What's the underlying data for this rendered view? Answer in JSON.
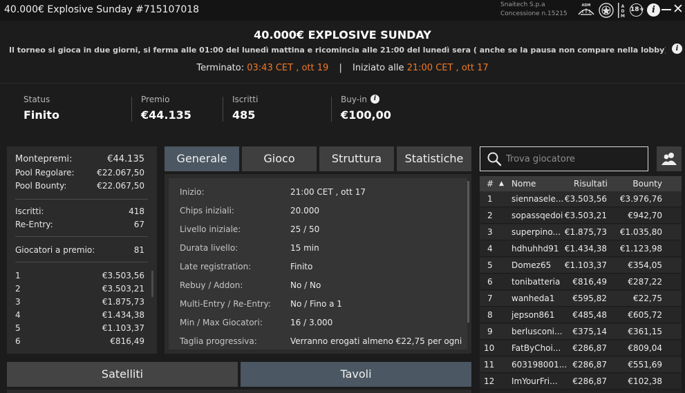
{
  "window": {
    "title": "40.000€ Explosive Sunday #715107018",
    "company_line1": "Snaitech S.p.a",
    "company_line2": "Concessione n.15215",
    "adm_text": "ADM",
    "age_badge": "18+",
    "icons": [
      "adm-ship-logo",
      "state-emblem-logo",
      "adm-logo",
      "age-18-icon",
      "info-icon",
      "minimize-icon",
      "close-icon"
    ]
  },
  "header": {
    "tournament_name": "40.000€ EXPLOSIVE SUNDAY",
    "description": "Il torneo si gioca in due giorni, si ferma alle 01:00 del lunedì mattina e ricomincia alle 21:00 del lunedì sera ( anche se la pausa non compare nella lobby)....",
    "ended_label": "Terminato:",
    "ended_value": "03:43 CET , ott 19",
    "separator": "|",
    "started_label": "Iniziato alle",
    "started_value": "21:00 CET , ott 17"
  },
  "stats": {
    "status_label": "Status",
    "status_value": "Finito",
    "prize_label": "Premio",
    "prize_value": "€44.135",
    "entrants_label": "Iscritti",
    "entrants_value": "485",
    "buyin_label": "Buy-in",
    "buyin_value": "€100,00"
  },
  "prize_panel": {
    "monte_label": "Montepremi:",
    "monte_value": "€44.135",
    "pool_reg_label": "Pool Regolare:",
    "pool_reg_value": "€22.067,50",
    "pool_bounty_label": "Pool Bounty:",
    "pool_bounty_value": "€22.067,50",
    "iscritti_label": "Iscritti:",
    "iscritti_value": "418",
    "reentry_label": "Re-Entry:",
    "reentry_value": "67",
    "paid_label": "Giocatori a premio:",
    "paid_value": "81",
    "places": [
      {
        "pos": "1",
        "amount": "€3.503,56"
      },
      {
        "pos": "2",
        "amount": "€3.503,21"
      },
      {
        "pos": "3",
        "amount": "€1.875,73"
      },
      {
        "pos": "4",
        "amount": "€1.434,38"
      },
      {
        "pos": "5",
        "amount": "€1.103,37"
      },
      {
        "pos": "6",
        "amount": "€816,49"
      }
    ]
  },
  "tabs": [
    "Generale",
    "Gioco",
    "Struttura",
    "Statistiche"
  ],
  "active_tab": "Generale",
  "general": [
    {
      "label": "Inizio:",
      "value": "21:00 CET , ott 17"
    },
    {
      "label": "Chips iniziali:",
      "value": "20.000"
    },
    {
      "label": "Livello iniziale:",
      "value": "25 / 50"
    },
    {
      "label": "Durata livello:",
      "value": "15 min"
    },
    {
      "label": "Late registration:",
      "value": "Finito"
    },
    {
      "label": "Rebuy / Addon:",
      "value": "No / No"
    },
    {
      "label": "Multi-Entry / Re-Entry:",
      "value": "No / Fino a 1"
    },
    {
      "label": "Min / Max Giocatori:",
      "value": "16 / 3.000"
    },
    {
      "label": "Taglia progressiva:",
      "value": "Verranno erogati almeno €22,75 per ogni"
    }
  ],
  "buttons": {
    "satelliti": "Satelliti",
    "tavoli": "Tavoli"
  },
  "search": {
    "placeholder": "Trova giocatore"
  },
  "players": {
    "headers": {
      "rank": "#",
      "sort": "▲",
      "name": "Nome",
      "results": "Risultati",
      "bounty": "Bounty"
    },
    "rows": [
      {
        "rank": "1",
        "name": "siennasele...",
        "result": "€3.503,56",
        "bounty": "€3.976,76"
      },
      {
        "rank": "2",
        "name": "sopassqedoi",
        "result": "€3.503,21",
        "bounty": "€942,70"
      },
      {
        "rank": "3",
        "name": "superpino...",
        "result": "€1.875,73",
        "bounty": "€1.035,80"
      },
      {
        "rank": "4",
        "name": "hdhuhhd91",
        "result": "€1.434,38",
        "bounty": "€1.123,98"
      },
      {
        "rank": "5",
        "name": "Domez65",
        "result": "€1.103,37",
        "bounty": "€354,05"
      },
      {
        "rank": "6",
        "name": "tonibatteria",
        "result": "€816,49",
        "bounty": "€287,22"
      },
      {
        "rank": "7",
        "name": "wanheda1",
        "result": "€595,82",
        "bounty": "€22,75"
      },
      {
        "rank": "8",
        "name": "jepson861",
        "result": "€485,48",
        "bounty": "€605,72"
      },
      {
        "rank": "9",
        "name": "berlusconi...",
        "result": "€375,14",
        "bounty": "€361,15"
      },
      {
        "rank": "10",
        "name": "FatByChoi...",
        "result": "€286,87",
        "bounty": "€809,04"
      },
      {
        "rank": "11",
        "name": "603198001...",
        "result": "€286,87",
        "bounty": "€551,69"
      },
      {
        "rank": "12",
        "name": "ImYourFri...",
        "result": "€286,87",
        "bounty": "€102,38"
      }
    ]
  },
  "colors": {
    "accent_orange": "#f07a2a",
    "active_tab": "#4b5762",
    "panel": "#2b2b2b",
    "background": "#1c1c1c"
  }
}
